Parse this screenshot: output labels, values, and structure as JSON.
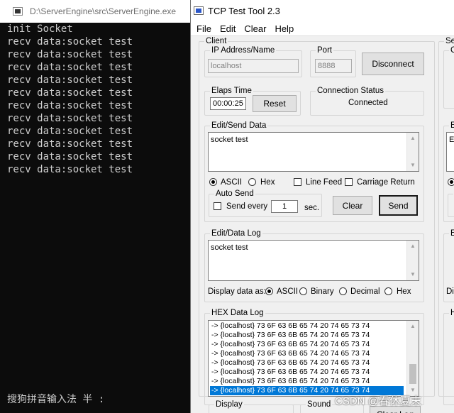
{
  "console": {
    "title": "D:\\ServerEngine\\src\\ServerEngine.exe",
    "lines": [
      "init Socket",
      "recv data:socket test",
      "recv data:socket test",
      "recv data:socket test",
      "recv data:socket test",
      "recv data:socket test",
      "recv data:socket test",
      "recv data:socket test",
      "recv data:socket test",
      "recv data:socket test",
      "recv data:socket test",
      "recv data:socket test"
    ],
    "ime_status": "搜狗拼音输入法 半 :"
  },
  "tcp": {
    "title": "TCP Test Tool 2.3",
    "menu": [
      "File",
      "Edit",
      "Clear",
      "Help"
    ],
    "client": {
      "legend": "Client",
      "ip_label": "IP Address/Name",
      "ip_value": "localhost",
      "port_label": "Port",
      "port_value": "8888",
      "disconnect_label": "Disconnect"
    },
    "elaps": {
      "legend": "Elaps Time",
      "value": "00:00:25",
      "reset_label": "Reset"
    },
    "connection": {
      "legend": "Connection Status",
      "status": "Connected"
    },
    "edit_send": {
      "legend": "Edit/Send Data",
      "text": "socket test",
      "ascii_label": "ASCII",
      "hex_label": "Hex",
      "line_feed_label": "Line Feed",
      "carriage_return_label": "Carriage Return",
      "auto_send_legend": "Auto Send",
      "send_every_label": "Send every",
      "interval_value": "1",
      "sec_label": "sec.",
      "clear_label": "Clear",
      "send_label": "Send"
    },
    "edit_log": {
      "legend": "Edit/Data Log",
      "text": "socket test",
      "display_as_label": "Display data as:",
      "options": [
        "ASCII",
        "Binary",
        "Decimal",
        "Hex"
      ],
      "selected": "ASCII"
    },
    "hex_log": {
      "legend": "HEX Data Log",
      "lines": [
        "-> {localhost} 73 6F 63 6B 65 74 20 74 65 73 74",
        "-> {localhost} 73 6F 63 6B 65 74 20 74 65 73 74",
        "-> {localhost} 73 6F 63 6B 65 74 20 74 65 73 74",
        "-> {localhost} 73 6F 63 6B 65 74 20 74 65 73 74",
        "-> {localhost} 73 6F 63 6B 65 74 20 74 65 73 74",
        "-> {localhost} 73 6F 63 6B 65 74 20 74 65 73 74",
        "-> {localhost} 73 6F 63 6B 65 74 20 74 65 73 74",
        "-> {localhost} 73 6F 63 6B 65 74 20 74 65 73 74"
      ]
    },
    "display": {
      "legend": "Display"
    },
    "sound": {
      "legend": "Sound"
    },
    "clear_log_label": "Clear Log",
    "server_fragments": {
      "server": "Serv",
      "cu": "Cu",
      "ed": "Ec",
      "en": "Er",
      "a": "A",
      "dis": "Dis",
      "he": "HE"
    }
  },
  "watermark": "CSDN @春休夏末"
}
